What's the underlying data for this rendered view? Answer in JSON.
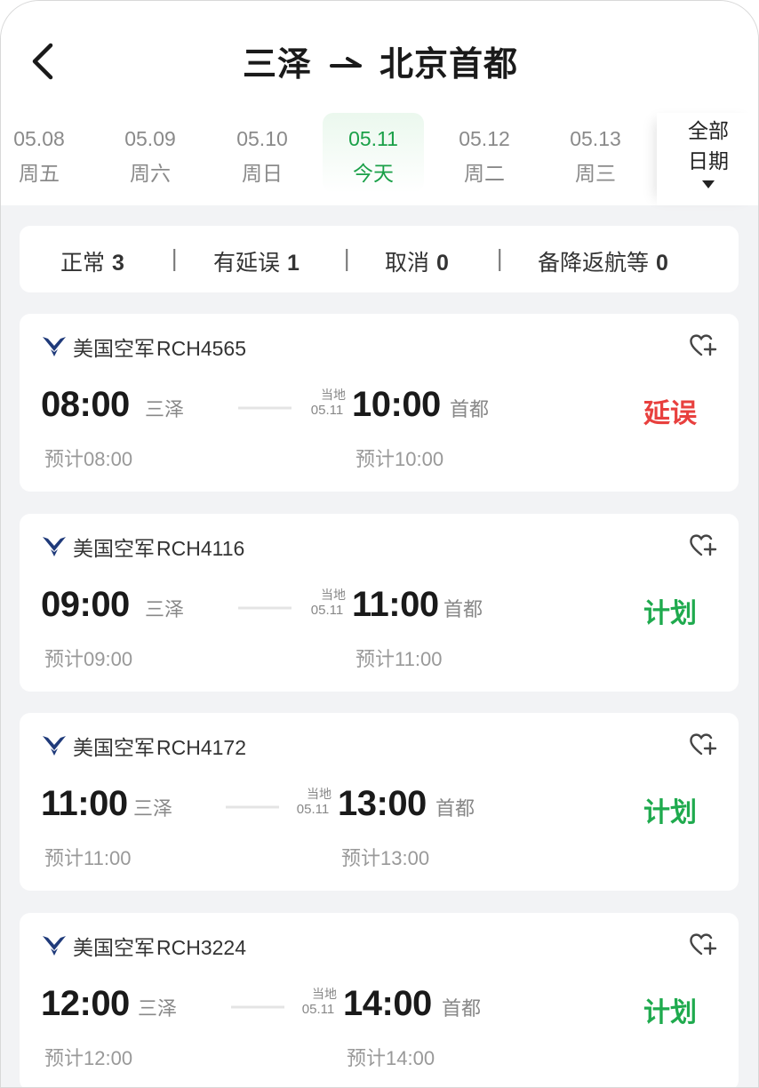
{
  "header": {
    "title_from": "三泽",
    "title_to": "北京首都"
  },
  "dates": [
    {
      "date": "05.08",
      "weekday": "周五",
      "active": false
    },
    {
      "date": "05.09",
      "weekday": "周六",
      "active": false
    },
    {
      "date": "05.10",
      "weekday": "周日",
      "active": false
    },
    {
      "date": "05.11",
      "weekday": "今天",
      "active": true
    },
    {
      "date": "05.12",
      "weekday": "周二",
      "active": false
    },
    {
      "date": "05.13",
      "weekday": "周三",
      "active": false
    }
  ],
  "all_dates": {
    "line1": "全部",
    "line2": "日期"
  },
  "summary": {
    "normal_label": "正常",
    "normal_count": "3",
    "delayed_label": "有延误",
    "delayed_count": "1",
    "cancel_label": "取消",
    "cancel_count": "0",
    "divert_label": "备降返航等",
    "divert_count": "0",
    "separator": "|"
  },
  "flights": [
    {
      "airline": "美国空军",
      "code": "RCH4565",
      "dep_time": "08:00",
      "dep_city": "三泽",
      "local_label": "当地",
      "arr_date": "05.11",
      "arr_time": "10:00",
      "arr_city": "首都",
      "status": "延误",
      "est_label": "预计",
      "est_dep": "08:00",
      "est_arr": "10:00"
    },
    {
      "airline": "美国空军",
      "code": "RCH4116",
      "dep_time": "09:00",
      "dep_city": "三泽",
      "local_label": "当地",
      "arr_date": "05.11",
      "arr_time": "11:00",
      "arr_city": "首都",
      "status": "计划",
      "est_label": "预计",
      "est_dep": "09:00",
      "est_arr": "11:00"
    },
    {
      "airline": "美国空军",
      "code": "RCH4172",
      "dep_time": "11:00",
      "dep_city": "三泽",
      "local_label": "当地",
      "arr_date": "05.11",
      "arr_time": "13:00",
      "arr_city": "首都",
      "status": "计划",
      "est_label": "预计",
      "est_dep": "11:00",
      "est_arr": "13:00"
    },
    {
      "airline": "美国空军",
      "code": "RCH3224",
      "dep_time": "12:00",
      "dep_city": "三泽",
      "local_label": "当地",
      "arr_date": "05.11",
      "arr_time": "14:00",
      "arr_city": "首都",
      "status": "计划",
      "est_label": "预计",
      "est_dep": "12:00",
      "est_arr": "14:00"
    }
  ],
  "colors": {
    "accent_green": "#1aa048",
    "delay_red": "#e8403e",
    "plan_green": "#1faa4e",
    "logo_blue": "#1f3a7a"
  },
  "icons": {
    "back": "chevron-left-icon",
    "arrow": "right-arrow-icon",
    "fav": "heart-plus-icon",
    "airline": "us-air-force-logo-icon",
    "dropdown": "triangle-down-icon"
  }
}
